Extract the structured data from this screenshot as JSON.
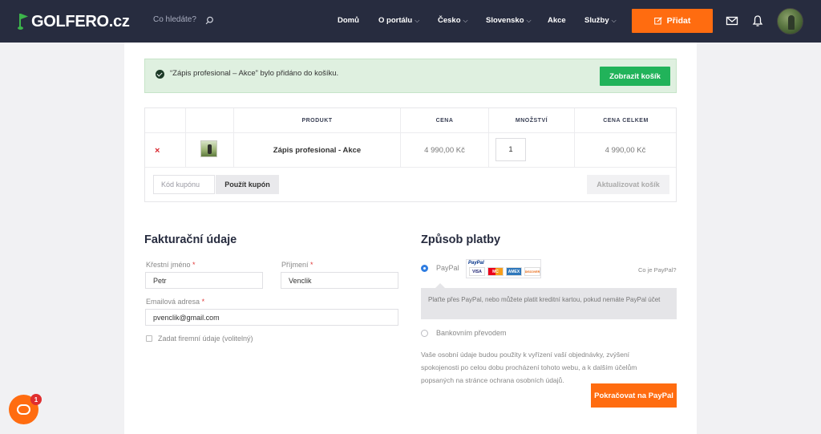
{
  "header": {
    "logo": "GOLFERO.cz",
    "search_placeholder": "Co hledáte?",
    "nav": [
      {
        "label": "Domů",
        "has_dropdown": false
      },
      {
        "label": "O portálu",
        "has_dropdown": true
      },
      {
        "label": "Česko",
        "has_dropdown": true
      },
      {
        "label": "Slovensko",
        "has_dropdown": true
      },
      {
        "label": "Akce",
        "has_dropdown": false
      },
      {
        "label": "Služby",
        "has_dropdown": true
      }
    ],
    "add_button": "Přidat",
    "accent_color": "#ff6c10"
  },
  "notice": {
    "message": "“Zápis profesional – Akce” bylo přidáno do košíku.",
    "button": "Zobrazit košík"
  },
  "cart": {
    "columns": [
      "PRODUKT",
      "CENA",
      "MNOŽSTVÍ",
      "CENA CELKEM"
    ],
    "rows": [
      {
        "product": "Zápis profesional - Akce",
        "price": "4 990,00 Kč",
        "quantity": "1",
        "total": "4 990,00 Kč"
      }
    ],
    "coupon_placeholder": "Kód kupónu",
    "apply_coupon": "Použít kupón",
    "update_cart": "Aktualizovat košík"
  },
  "billing": {
    "title": "Fakturační údaje",
    "first_name_label": "Křestní jméno",
    "first_name": "Petr",
    "last_name_label": "Příjmení",
    "last_name": "Venclik",
    "email_label": "Emailová adresa",
    "email": "pvenclik@gmail.com",
    "company_checkbox": "Zadat firemní údaje (volitelný)",
    "required_mark": "*"
  },
  "payment": {
    "title": "Způsob platby",
    "paypal_label": "PayPal",
    "paypal_logo": "PayPal",
    "cards": [
      "VISA",
      "MC",
      "AMEX",
      "DISCOVER"
    ],
    "what_is": "Co je PayPal?",
    "paypal_description": "Plaťte přes PayPal, nebo můžete platit kreditní kartou, pokud nemáte PayPal účet",
    "bank_label": "Bankovním převodem",
    "privacy_text": "Vaše osobní údaje budou použity k vyřízení vaší objednávky, zvýšení spokojenosti po celou dobu procházení tohoto webu, a k dalším účelům popsaných na stránce ochrana osobních údajů.",
    "submit": "Pokračovat na PayPal"
  },
  "chat": {
    "badge": "1"
  }
}
